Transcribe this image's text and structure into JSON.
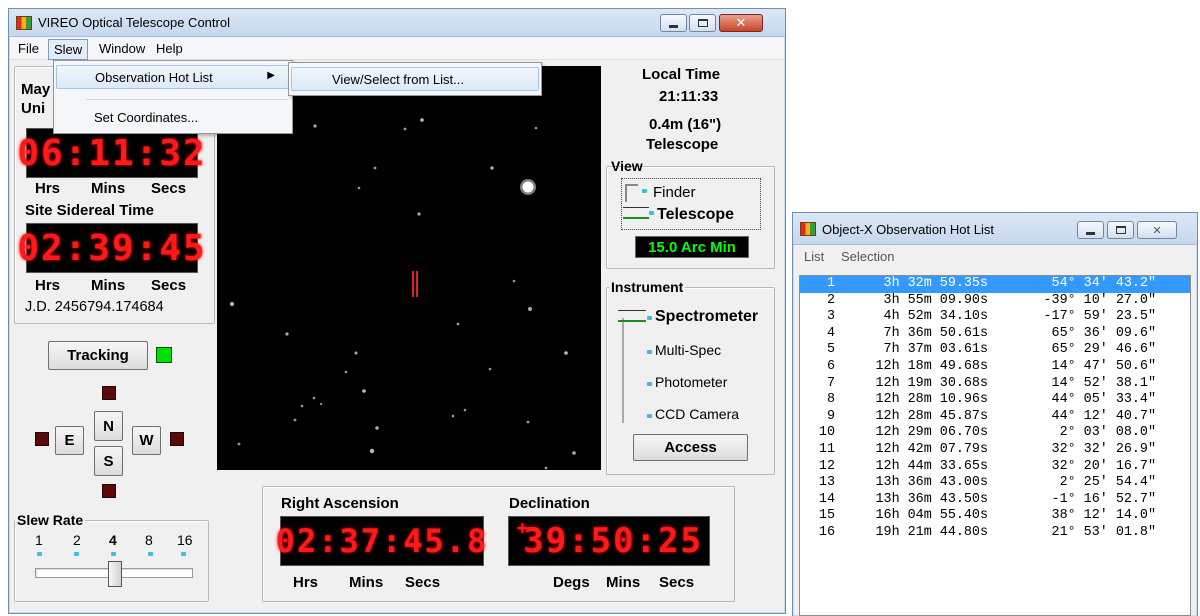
{
  "main_window": {
    "title": "VIREO Optical Telescope Control",
    "menu": [
      "File",
      "Slew",
      "Window",
      "Help"
    ],
    "slew_menu": {
      "items": [
        "Observation Hot List",
        "Set Coordinates..."
      ]
    },
    "hotlist_submenu": {
      "items": [
        "View/Select from List..."
      ]
    }
  },
  "clocks": {
    "obscured_title_1": "May",
    "obscured_title_2": "Uni",
    "ut_display": "06:11:32",
    "ut_units": [
      "Hrs",
      "Mins",
      "Secs"
    ],
    "sidereal_title": "Site Sidereal Time",
    "sidereal_display": "02:39:45",
    "sidereal_units": [
      "Hrs",
      "Mins",
      "Secs"
    ],
    "jd": "J.D. 2456794.174684"
  },
  "tracking": {
    "label": "Tracking",
    "indicator_color": "#00e000"
  },
  "directions": {
    "n": "N",
    "s": "S",
    "e": "E",
    "w": "W"
  },
  "slew_rate": {
    "title": "Slew Rate",
    "ticks": [
      "1",
      "2",
      "4",
      "8",
      "16"
    ],
    "selected": "4"
  },
  "local_time": {
    "label": "Local Time",
    "value": "21:11:33",
    "telescope_size": "0.4m (16\")",
    "telescope_label": "Telescope"
  },
  "view": {
    "title": "View",
    "options": [
      "Finder",
      "Telescope"
    ],
    "selected": "Telescope",
    "field": "15.0 Arc Min"
  },
  "instrument": {
    "title": "Instrument",
    "options": [
      "Spectrometer",
      "Multi-Spec",
      "Photometer",
      "CCD Camera"
    ],
    "selected": "Spectrometer",
    "access_label": "Access"
  },
  "coordinates": {
    "ra_title": "Right Ascension",
    "ra_display": "02:37:45.8",
    "ra_units": [
      "Hrs",
      "Mins",
      "Secs"
    ],
    "dec_title": "Declination",
    "dec_sign": "+",
    "dec_display": "39:50:25",
    "dec_units": [
      "Degs",
      "Mins",
      "Secs"
    ]
  },
  "hotlist_window": {
    "title": "Object-X Observation Hot List",
    "menu": [
      "List",
      "Selection"
    ],
    "rows": [
      {
        "n": "1",
        "ra": "3h 32m 59.35s",
        "dec": "54° 34' 43.2\""
      },
      {
        "n": "2",
        "ra": "3h 55m 09.90s",
        "dec": "-39° 10' 27.0\""
      },
      {
        "n": "3",
        "ra": "4h 52m 34.10s",
        "dec": "-17° 59' 23.5\""
      },
      {
        "n": "4",
        "ra": "7h 36m 50.61s",
        "dec": "65° 36' 09.6\""
      },
      {
        "n": "5",
        "ra": "7h 37m 03.61s",
        "dec": "65° 29' 46.6\""
      },
      {
        "n": "6",
        "ra": "12h 18m 49.68s",
        "dec": "14° 47' 50.6\""
      },
      {
        "n": "7",
        "ra": "12h 19m 30.68s",
        "dec": "14° 52' 38.1\""
      },
      {
        "n": "8",
        "ra": "12h 28m 10.96s",
        "dec": "44° 05' 33.4\""
      },
      {
        "n": "9",
        "ra": "12h 28m 45.87s",
        "dec": "44° 12' 40.7\""
      },
      {
        "n": "10",
        "ra": "12h 29m 06.70s",
        "dec": "2° 03' 08.0\""
      },
      {
        "n": "11",
        "ra": "12h 42m 07.79s",
        "dec": "32° 32' 26.9\""
      },
      {
        "n": "12",
        "ra": "12h 44m 33.65s",
        "dec": "32° 20' 16.7\""
      },
      {
        "n": "13",
        "ra": "13h 36m 43.00s",
        "dec": "2° 25' 54.4\""
      },
      {
        "n": "14",
        "ra": "13h 36m 43.50s",
        "dec": "-1° 16' 52.7\""
      },
      {
        "n": "15",
        "ra": "16h 04m 55.40s",
        "dec": "38° 12' 14.0\""
      },
      {
        "n": "16",
        "ra": "19h 21m 44.80s",
        "dec": "21° 53' 01.8\""
      }
    ],
    "selected_row": "1"
  },
  "colors": {
    "led_red": "#ff1a1a",
    "field_green": "#00ff00",
    "selection_blue": "#3399ff"
  }
}
